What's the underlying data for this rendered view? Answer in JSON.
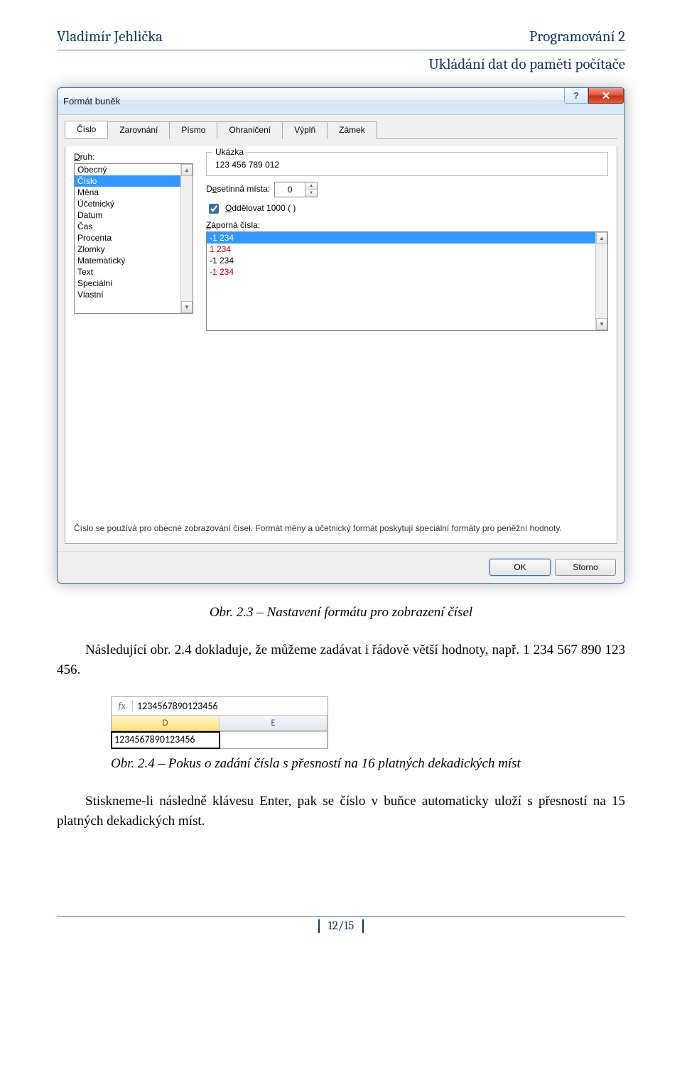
{
  "header": {
    "author": "Vladimír Jehlička",
    "course": "Programování 2",
    "subtitle": "Ukládání dat do paměti počítače"
  },
  "dialog": {
    "title": "Formát buněk",
    "help_symbol": "?",
    "close_symbol": "✕",
    "tabs": [
      "Číslo",
      "Zarovnání",
      "Písmo",
      "Ohraničení",
      "Výplň",
      "Zámek"
    ],
    "type_label_prefix": "D",
    "type_label_rest": "ruh:",
    "type_items": [
      "Obecný",
      "Číslo",
      "Měna",
      "Účetnický",
      "Datum",
      "Čas",
      "Procenta",
      "Zlomky",
      "Matematický",
      "Text",
      "Speciální",
      "Vlastní"
    ],
    "type_selected_index": 1,
    "sample_legend": "Ukázka",
    "sample_value": "123 456 789 012",
    "decimals_label_prefix": "D",
    "decimals_label_mid": "e",
    "decimals_label_rest": "setinná místa:",
    "decimals_value": "0",
    "sep_label_prefix": "O",
    "sep_label_rest": "ddělovat 1000 ( )",
    "sep_checked": true,
    "neg_label_prefix": "Z",
    "neg_label_rest": "áporná čísla:",
    "neg_items": [
      {
        "text": "-1 234",
        "red": false,
        "selected": true
      },
      {
        "text": "1 234",
        "red": true,
        "selected": false
      },
      {
        "text": "-1 234",
        "red": false,
        "selected": false
      },
      {
        "text": "-1 234",
        "red": true,
        "selected": false
      }
    ],
    "help_text": "Číslo se používá pro obecné zobrazování čísel. Formát měny a účetnický formát poskytují speciální formáty pro peněžní hodnoty.",
    "ok_label": "OK",
    "cancel_label": "Storno"
  },
  "caption1_prefix": "Obr. 2.3",
  "caption1_rest": " – Nastavení formátu pro zobrazení čísel",
  "para1_a": "Následující obr. 2.4 dokladuje, že můžeme zadávat i řádově větší hodnoty, např. 1 234 567 890 123 456.",
  "excel": {
    "fx_label": "fx",
    "fx_value": "1234567890123456",
    "cols": [
      "D",
      "E"
    ],
    "active_col_index": 0,
    "cell_value": "1234567890123456"
  },
  "caption2_prefix": "Obr. 2.4",
  "caption2_rest": " – Pokus o zadání čísla s přesností na 16 platných dekadických míst",
  "para2": "Stiskneme-li následně klávesu Enter, pak se číslo v buňce automaticky uloží s přesností na 15 platných dekadických míst.",
  "footer": {
    "page": "12/15"
  }
}
